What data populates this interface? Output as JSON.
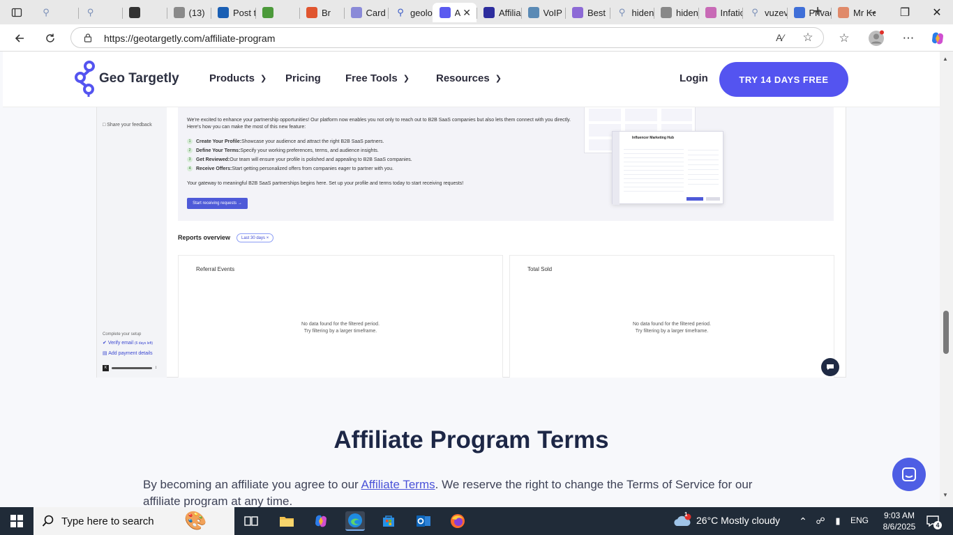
{
  "browser": {
    "tabs": [
      {
        "title": "",
        "icon": "search-icon",
        "color": "#7a8fb8"
      },
      {
        "title": "",
        "icon": "search-icon",
        "color": "#7a8fb8"
      },
      {
        "title": "",
        "icon": "chatgpt-icon",
        "color": "#333333"
      },
      {
        "title": "(13)",
        "icon": "b-icon",
        "color": "#8a8a8a"
      },
      {
        "title": "Post t",
        "icon": "xf-icon",
        "color": "#1a5fb4"
      },
      {
        "title": "",
        "icon": "puzzle-icon",
        "color": "#4c9a3b"
      },
      {
        "title": "Br",
        "icon": "brave-icon",
        "color": "#e0552f"
      },
      {
        "title": "Card",
        "icon": "c-icon",
        "color": "#8a8ad8"
      },
      {
        "title": "geolo",
        "icon": "search-icon",
        "color": "#3a5bc7"
      },
      {
        "title": "A",
        "icon": "geotargetly-icon",
        "color": "#5b5bf0",
        "active": true
      },
      {
        "title": "Affilia",
        "icon": "affiliate-icon",
        "color": "#2e2e9e"
      },
      {
        "title": "VoIP",
        "icon": "voip-icon",
        "color": "#5a8ab5"
      },
      {
        "title": "Best",
        "icon": "best-icon",
        "color": "#8d6ad6"
      },
      {
        "title": "hiden",
        "icon": "search-icon",
        "color": "#7a8fb8"
      },
      {
        "title": "hiden",
        "icon": "shield-icon",
        "color": "#888888"
      },
      {
        "title": "Infatic",
        "icon": "infatica-icon",
        "color": "#c86ab6"
      },
      {
        "title": "vuzev",
        "icon": "search-icon",
        "color": "#7a8fb8"
      },
      {
        "title": "Privac",
        "icon": "privacy-icon",
        "color": "#3f6fd8"
      },
      {
        "title": "Mr Ke",
        "icon": "mk-icon",
        "color": "#e08a6a"
      }
    ],
    "url": "https://geotargetly.com/affiliate-program"
  },
  "site": {
    "logo_text": "Geo Targetly",
    "nav": {
      "products": "Products",
      "pricing": "Pricing",
      "free_tools": "Free Tools",
      "resources": "Resources",
      "login": "Login",
      "cta": "TRY 14 DAYS FREE"
    },
    "accent": "#5454f0"
  },
  "mock": {
    "side_feedback": "Share your feedback",
    "side_setup": "Complete your setup",
    "side_verify": "Verify email",
    "side_verify_badge": "(6 days left)",
    "side_payment": "Add payment details",
    "side_account": "K",
    "intro": "We're excited to enhance your partnership opportunities! Our platform now enables you not only to reach out to B2B SaaS companies but also lets them connect with you directly. Here's how you can make the most of this new feature:",
    "steps": [
      {
        "num": "1",
        "bold": "Create Your Profile:",
        "text": "Showcase your audience and attract the right B2B SaaS partners."
      },
      {
        "num": "2",
        "bold": "Define Your Terms:",
        "text": "Specify your working preferences, terms, and audience insights."
      },
      {
        "num": "3",
        "bold": "Get Reviewed:",
        "text": "Our team will ensure your profile is polished and appealing to B2B SaaS companies."
      },
      {
        "num": "4",
        "bold": "Receive Offers:",
        "text": "Start getting personalized offers from companies eager to partner with you."
      }
    ],
    "gateway": "Your gateway to meaningful B2B SaaS partnerships begins here. Set up your profile and terms today to start receiving requests!",
    "promo_button": "Start receiving requests →",
    "preview_title": "Influencer Marketing Hub",
    "reports_title": "Reports overview",
    "filter_chip": "Last 30 days ×",
    "panels": [
      {
        "title": "Referral Events",
        "empty1": "No data found for the filtered period.",
        "empty2": "Try filtering by a larger timeframe."
      },
      {
        "title": "Total Sold",
        "empty1": "No data found for the filtered period.",
        "empty2": "Try filtering by a larger timeframe."
      }
    ]
  },
  "terms": {
    "title": "Affiliate Program Terms",
    "body_before": "By becoming an affiliate you agree to our ",
    "link": "Affiliate Terms",
    "body_after": ". We reserve the right to change the Terms of Service for our affiliate program at any time."
  },
  "taskbar": {
    "search_placeholder": "Type here to search",
    "weather_badge": "1",
    "weather": "26°C  Mostly cloudy",
    "lang": "ENG",
    "time": "9:03 AM",
    "date": "8/6/2025",
    "notif_count": "4"
  }
}
